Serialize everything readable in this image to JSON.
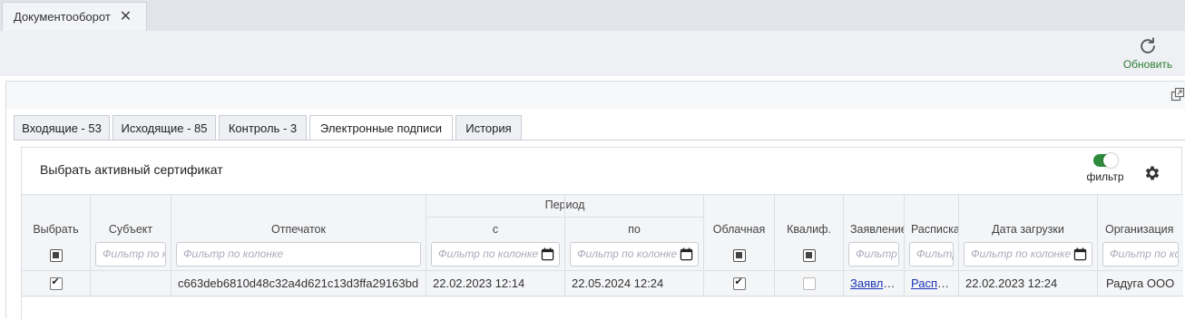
{
  "window": {
    "tab_title": "Документооборот",
    "close_glyph": "✕"
  },
  "toolbar": {
    "refresh_label": "Обновить"
  },
  "tabs": [
    {
      "label": "Входящие - 53"
    },
    {
      "label": "Исходящие - 85"
    },
    {
      "label": "Контроль - 3"
    },
    {
      "label": "Электронные подписи",
      "active": true
    },
    {
      "label": "История"
    }
  ],
  "card": {
    "title": "Выбрать активный сертификат",
    "filter_toggle_label": "фильтр",
    "filter_toggle_on": true
  },
  "grid": {
    "group_header": "Период",
    "columns": {
      "select": "Выбрать",
      "subject": "Субъект",
      "thumbprint": "Отпечаток",
      "from": "с",
      "to": "по",
      "cloud": "Облачная",
      "qualified": "Квалиф.",
      "application": "Заявление",
      "receipt": "Расписка",
      "upload_date": "Дата загрузки",
      "organization": "Организация"
    },
    "filters": {
      "subject": "Фильтр по колонке",
      "thumbprint": "Фильтр по колонке",
      "from": "Фильтр по колонке",
      "to": "Фильтр по колонке",
      "application": "Фильтр по колонке",
      "receipt": "Фильтр по колонке",
      "upload_date": "Фильтр по колонке",
      "organization": "Фильтр по колонке"
    },
    "rows": [
      {
        "selected": true,
        "subject": "",
        "thumbprint": "c663deb6810d48c32a4d621c13d3ffa29163bd",
        "from": "22.02.2023 12:14",
        "to": "22.05.2024 12:24",
        "cloud": true,
        "qualified": false,
        "application": "Заявление",
        "receipt": "Расписка",
        "upload_date": "22.02.2023 12:24",
        "organization": "Радуга ООО"
      }
    ]
  },
  "colors": {
    "accent_green": "#2e7d32",
    "link": "#1a35b8"
  }
}
